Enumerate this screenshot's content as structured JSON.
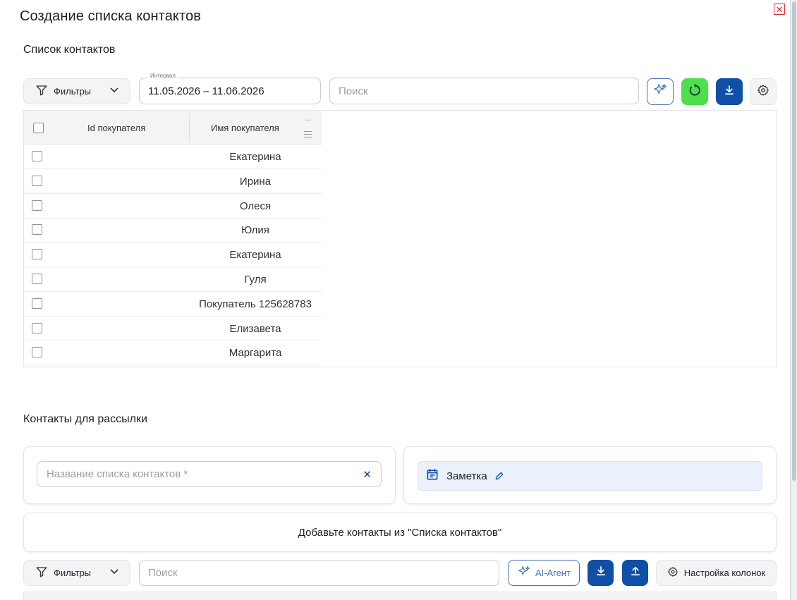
{
  "dialog": {
    "title": "Создание списка контактов",
    "close_icon": "close-icon",
    "accent_color": "#0f4fa5",
    "close_color": "#d62b2b",
    "refresh_color": "#4ee04c"
  },
  "contacts_section": {
    "title": "Список контактов",
    "filters_label": "Фильтры",
    "interval_label": "Интервал",
    "interval_value": "11.05.2026 – 11.06.2026",
    "search_placeholder": "Поиск",
    "columns": [
      "Id покупателя",
      "Имя покупателя"
    ],
    "column_menu": "...",
    "rows": [
      {
        "id": "",
        "name": "Екатерина"
      },
      {
        "id": "",
        "name": "Ирина"
      },
      {
        "id": "",
        "name": "Олеся"
      },
      {
        "id": "",
        "name": "Юлия"
      },
      {
        "id": "",
        "name": "Екатерина"
      },
      {
        "id": "",
        "name": "Гуля"
      },
      {
        "id": "",
        "name": "Покупатель 125628783"
      },
      {
        "id": "",
        "name": "Елизавета"
      },
      {
        "id": "",
        "name": "Маргарита"
      }
    ]
  },
  "mailing_section": {
    "title": "Контакты для рассылки",
    "list_name_placeholder": "Название списка контактов *",
    "note_label": "Заметка",
    "hint_text": "Добавьте контакты из \"Списка контактов\"",
    "filters_label": "Фильтры",
    "search_placeholder": "Поиск",
    "ai_agent_label": "AI-Агент",
    "columns_settings_label": "Настройка колонок"
  }
}
